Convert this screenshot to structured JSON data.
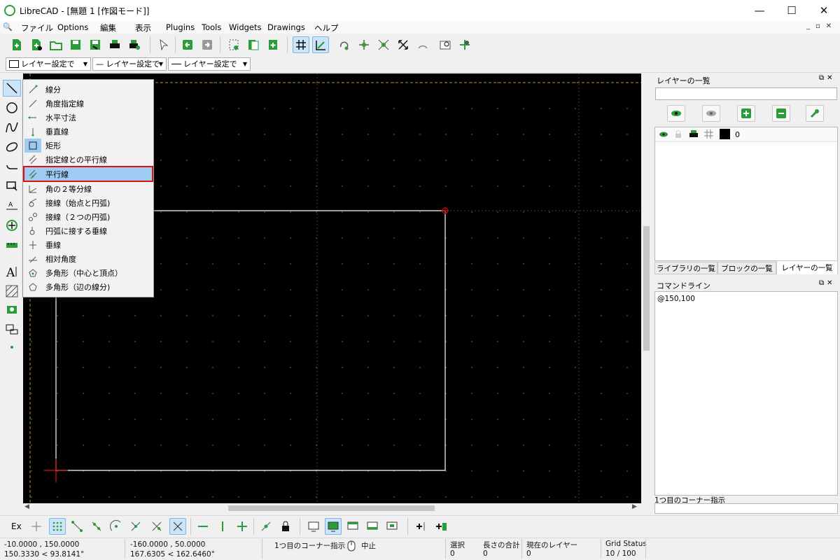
{
  "window": {
    "title": "LibreCAD - [無題 1 [作図モード]]",
    "minimize": "—",
    "maximize": "☐",
    "close": "✕"
  },
  "menu": [
    "ファイル",
    "Options",
    "編集",
    "表示",
    "Plugins",
    "Tools",
    "Widgets",
    "Drawings",
    "ヘルプ"
  ],
  "toolbar_combos": {
    "color": "レイヤー設定で",
    "width": "— レイヤー設定で",
    "linetype": "レイヤー設定で"
  },
  "line_menu": {
    "items": [
      {
        "label": "線分",
        "icon": "line-2p-icon"
      },
      {
        "label": "角度指定線",
        "icon": "line-angle-icon"
      },
      {
        "label": "水平寸法",
        "icon": "line-horizontal-icon"
      },
      {
        "label": "垂直線",
        "icon": "line-vertical-icon"
      },
      {
        "label": "矩形",
        "icon": "rectangle-icon"
      },
      {
        "label": "指定線との平行線",
        "icon": "parallel-through-point-icon"
      },
      {
        "label": "平行線",
        "icon": "parallel-line-icon"
      },
      {
        "label": "角の２等分線",
        "icon": "bisector-icon"
      },
      {
        "label": "接線（始点と円弧)",
        "icon": "tangent-point-arc-icon"
      },
      {
        "label": "接線（２つの円弧)",
        "icon": "tangent-two-arcs-icon"
      },
      {
        "label": "円弧に接する垂線",
        "icon": "orthogonal-tangent-icon"
      },
      {
        "label": "垂線",
        "icon": "orthogonal-icon"
      },
      {
        "label": "相対角度",
        "icon": "relative-angle-icon"
      },
      {
        "label": "多角形（中心と頂点）",
        "icon": "polygon-center-icon"
      },
      {
        "label": "多角形（辺の線分)",
        "icon": "polygon-side-icon"
      }
    ],
    "highlighted": "平行線"
  },
  "layer_panel": {
    "title": "レイヤーの一覧",
    "search_value": "",
    "layers": [
      {
        "name": "0",
        "color": "#000000"
      }
    ],
    "tabs": [
      "ライブラリの一覧",
      "ブロックの一覧",
      "レイヤーの一覧"
    ]
  },
  "command_panel": {
    "title": "コマンドライン",
    "history": "@150,100",
    "prompt": "1つ目のコーナー指示"
  },
  "bottom_toolbar": {
    "ex_label": "Ex"
  },
  "status": {
    "abs_coord": "-10.0000 , 150.0000",
    "abs_polar": "150.3330 < 93.8141°",
    "rel_coord": "-160.0000 , 50.0000",
    "rel_polar": "167.6305 < 162.6460°",
    "mouse_left": "1つ目のコーナー指示",
    "mouse_right": "中止",
    "selected_label": "選択",
    "selected_value": "0",
    "length_label": "長さの合計",
    "length_value": "0",
    "layer_label": "現在のレイヤー",
    "layer_value": "0",
    "grid_label": "Grid Status",
    "grid_value": "10 / 100"
  },
  "colors": {
    "accent": "#2a9d3a",
    "canvas": "#000000",
    "highlight": "#9ecbf2",
    "highlight_border": "#e01010",
    "crosshair": "#e01010",
    "drawing_line": "#ffffff",
    "grid_dot": "#5a5a5a",
    "page_border": "#c88a2a"
  }
}
